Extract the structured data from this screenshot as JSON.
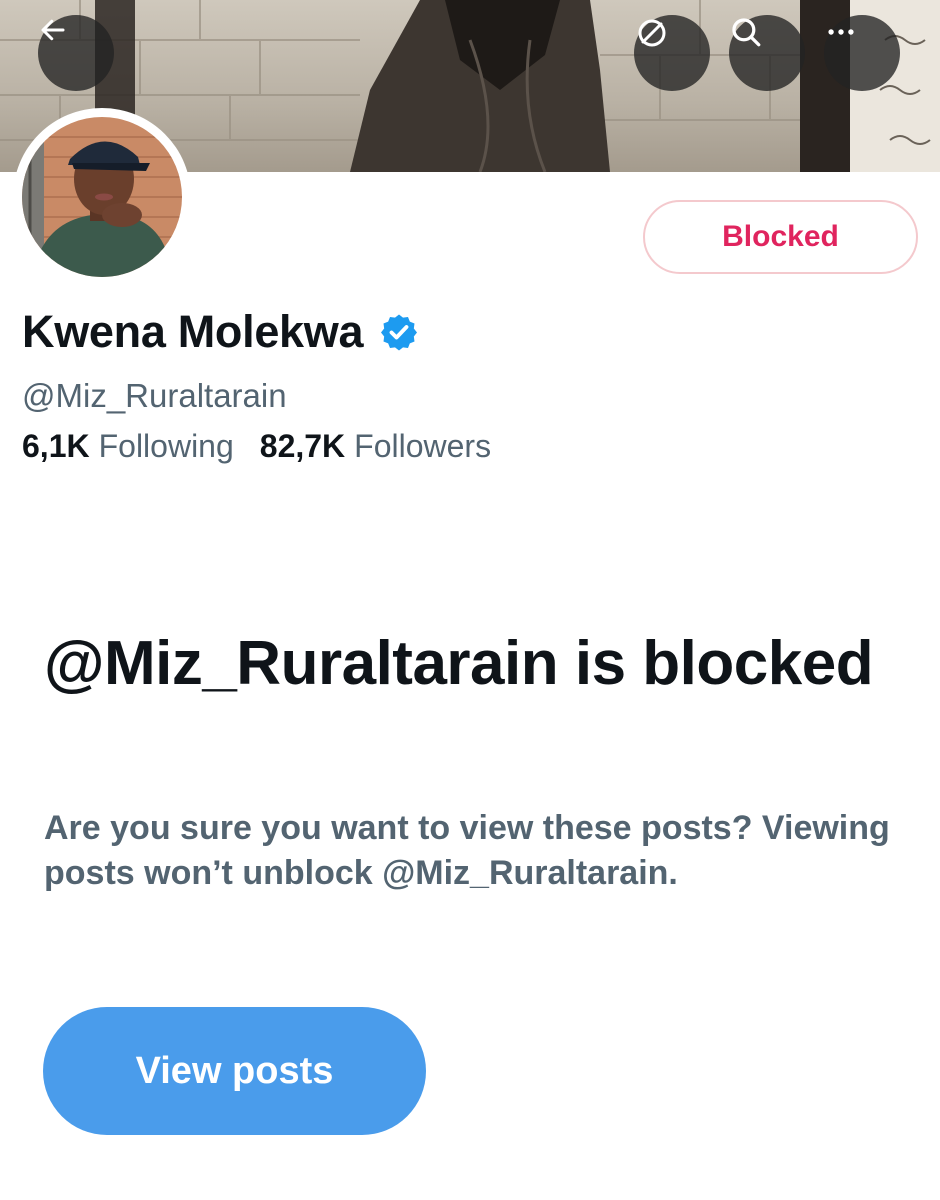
{
  "header": {
    "back_icon": "arrow-left-icon",
    "actions": [
      {
        "icon": "globe-off-icon"
      },
      {
        "icon": "search-icon"
      },
      {
        "icon": "more-icon"
      }
    ]
  },
  "profile": {
    "display_name": "Kwena Molekwa",
    "verified": true,
    "handle": "@Miz_Ruraltarain",
    "following_count": "6,1K",
    "following_label": "Following",
    "followers_count": "82,7K",
    "followers_label": "Followers",
    "blocked_button_label": "Blocked"
  },
  "blocked_notice": {
    "title": "@Miz_Ruraltarain is blocked",
    "body": "Are you sure you want to view these posts? Viewing posts won’t unblock @Miz_Ruraltarain.",
    "view_posts_label": "View posts"
  },
  "colors": {
    "text_primary": "#0f1419",
    "text_secondary": "#536471",
    "blocked_red": "#e0245e",
    "blocked_border": "#f4c9cd",
    "verified_blue": "#1d9bf0",
    "view_posts_button": "#4a9ceb"
  }
}
